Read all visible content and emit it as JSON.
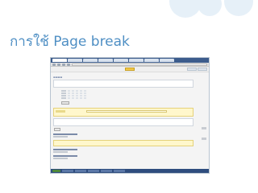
{
  "slide": {
    "title": "การใช้ Page break"
  },
  "colors": {
    "title": "#4f8fc4",
    "window_titlebar": "#3c5c8c",
    "page_break_band": "#fff7cc",
    "help_button": "#f3c94a",
    "taskbar": "#2f4d7e"
  },
  "icons": {
    "back": "back-icon",
    "forward": "forward-icon",
    "refresh": "refresh-icon",
    "home": "home-icon"
  }
}
